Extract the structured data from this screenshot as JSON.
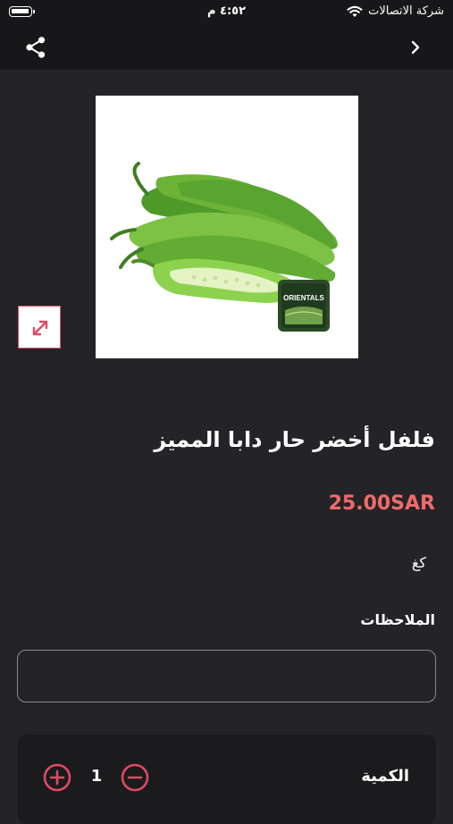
{
  "status_bar": {
    "carrier": "شركة الاتصالات",
    "time": "٤:٥٢ م",
    "icons": [
      "wifi-icon",
      "battery-icon"
    ]
  },
  "nav": {
    "icons": [
      "share-icon",
      "chevron-right-icon"
    ]
  },
  "product": {
    "title": "فلفل أخضر حار دابا المميز",
    "price": "25.00SAR",
    "unit": "كغ",
    "image_logo_text": "ORIENTALS"
  },
  "notes": {
    "label": "الملاحظات",
    "value": ""
  },
  "quantity": {
    "label": "الكمية",
    "value": "1",
    "icons": [
      "plus-circle-icon",
      "minus-circle-icon"
    ]
  },
  "colors": {
    "background": "#242428",
    "bar": "#17171a",
    "accent": "#e04a62",
    "price": "#f06a6a"
  }
}
